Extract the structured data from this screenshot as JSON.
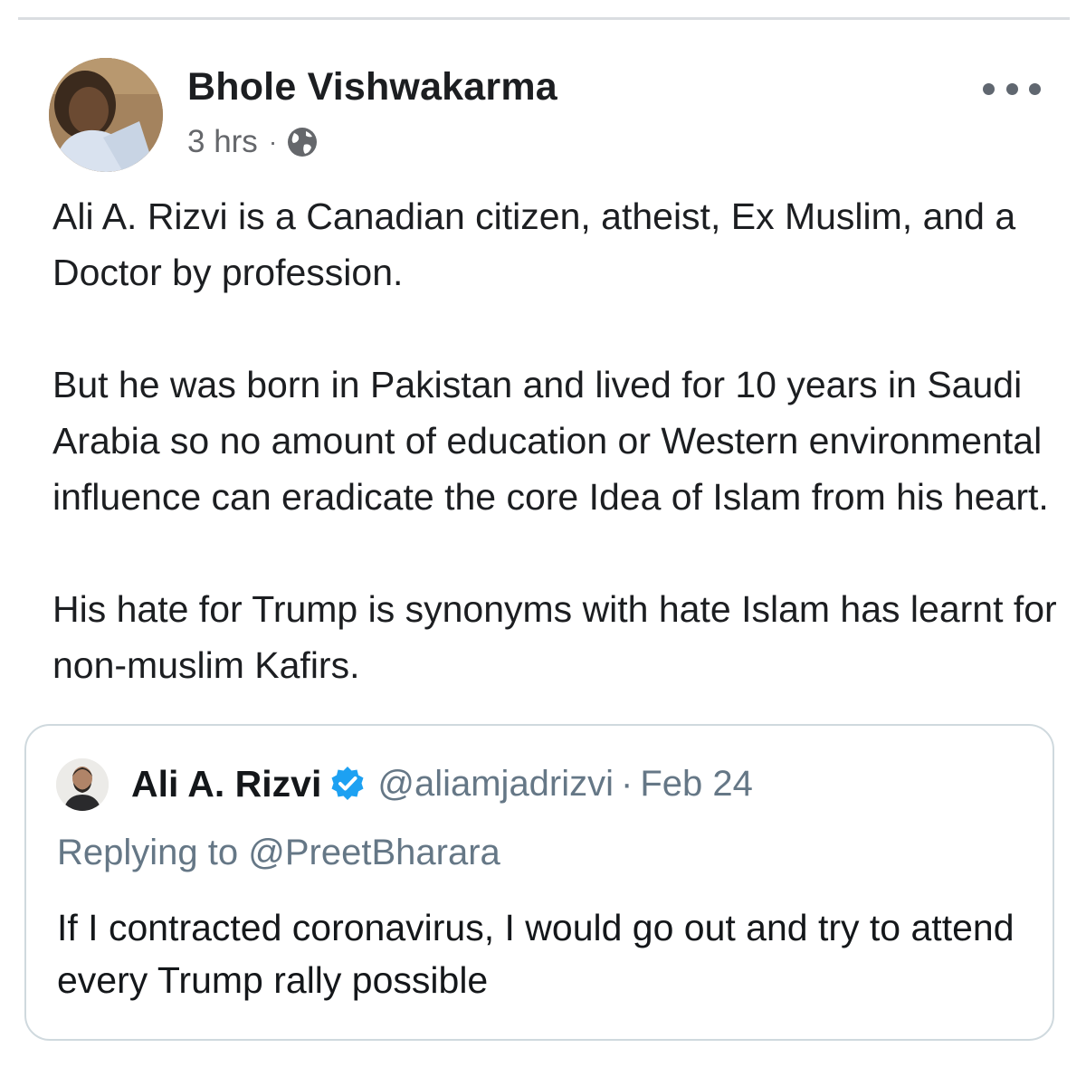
{
  "post": {
    "author_name": "Bhole Vishwakarma",
    "timestamp": "3 hrs",
    "separator": "·",
    "audience_icon": "globe-icon",
    "options_icon": "more-options-icon",
    "paragraphs": [
      "Ali A. Rizvi is a Canadian citizen, atheist, Ex Muslim, and a Doctor by profession.",
      "But he was born in Pakistan and lived for 10 years in Saudi Arabia so no amount of education or Western environmental influence can eradicate the core Idea of Islam from his heart.",
      "His hate for Trump is synonyms with hate Islam has learnt for non-muslim Kafirs."
    ]
  },
  "quoted_tweet": {
    "name": "Ali A. Rizvi",
    "verified_icon": "verified-badge-icon",
    "handle": "@aliamjadrizvi",
    "separator": "·",
    "date": "Feb 24",
    "replying_label": "Replying to",
    "replying_to": "@PreetBharara",
    "text": "If I contracted coronavirus, I would go out and try to attend every Trump rally possible"
  },
  "colors": {
    "primary_text": "#1c1e21",
    "secondary_text": "#65676b",
    "twitter_secondary": "#657786",
    "verified_blue": "#1da1f2",
    "card_border": "#cfd9de"
  }
}
